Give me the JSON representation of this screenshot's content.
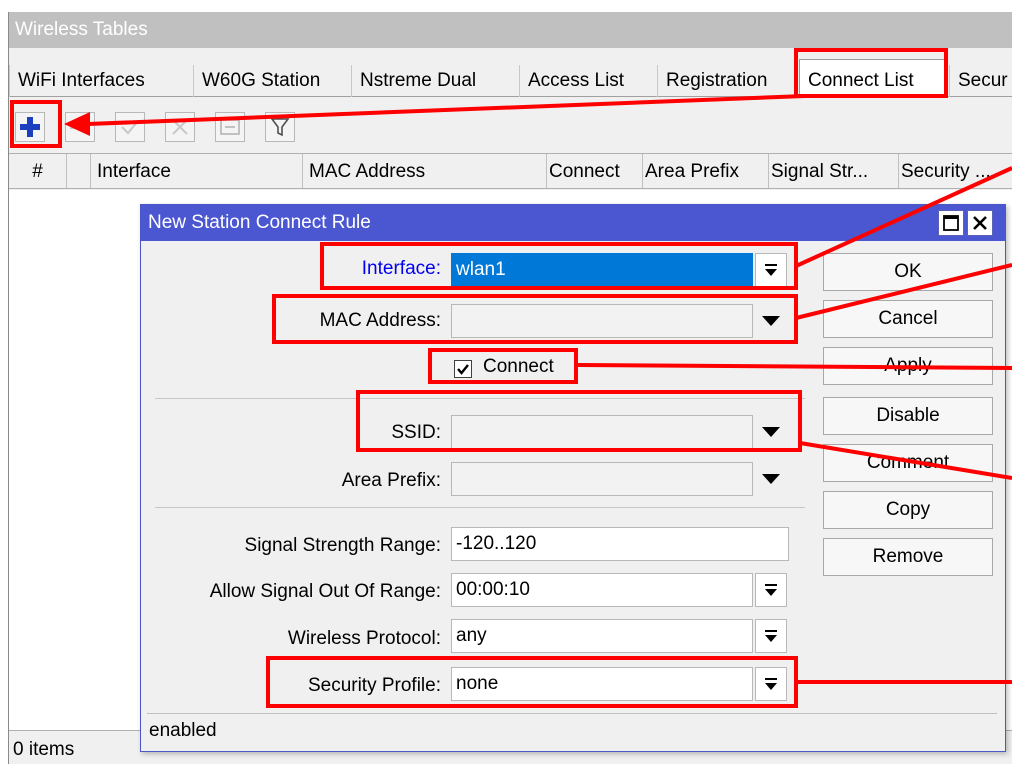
{
  "window": {
    "title": "Wireless Tables"
  },
  "tabs": [
    {
      "label": "WiFi Interfaces"
    },
    {
      "label": "W60G Station"
    },
    {
      "label": "Nstreme Dual"
    },
    {
      "label": "Access List"
    },
    {
      "label": "Registration"
    },
    {
      "label": "Connect List"
    },
    {
      "label": "Secur"
    }
  ],
  "active_tab": "Connect List",
  "toolbar": {
    "buttons": [
      "add-icon",
      "remove-icon",
      "enable-icon",
      "disable-icon",
      "comment-icon",
      "filter-icon"
    ]
  },
  "columns": [
    "#",
    "Interface",
    "MAC Address",
    "Connect",
    "Area Prefix",
    "Signal Str...",
    "Security ..."
  ],
  "status": {
    "items": "0 items"
  },
  "dialog": {
    "title": "New Station Connect Rule",
    "fields": {
      "interface": {
        "label": "Interface:",
        "value": "wlan1"
      },
      "mac_address": {
        "label": "MAC Address:",
        "value": ""
      },
      "connect": {
        "label": "Connect",
        "checked": true
      },
      "ssid": {
        "label": "SSID:",
        "value": ""
      },
      "area_prefix": {
        "label": "Area Prefix:",
        "value": ""
      },
      "signal_strength_range": {
        "label": "Signal Strength Range:",
        "value": "-120..120"
      },
      "allow_signal_out_of_range": {
        "label": "Allow Signal Out Of Range:",
        "value": "00:00:10"
      },
      "wireless_protocol": {
        "label": "Wireless Protocol:",
        "value": "any"
      },
      "security_profile": {
        "label": "Security Profile:",
        "value": "none"
      }
    },
    "buttons": {
      "ok": "OK",
      "cancel": "Cancel",
      "apply": "Apply",
      "disable": "Disable",
      "comment": "Comment",
      "copy": "Copy",
      "remove": "Remove"
    },
    "status": "enabled"
  },
  "colors": {
    "dialog_title": "#4b57d0",
    "annotation_red": "#ff0000",
    "link_label": "#0000ee",
    "selected_value_bg": "#0078d7"
  }
}
